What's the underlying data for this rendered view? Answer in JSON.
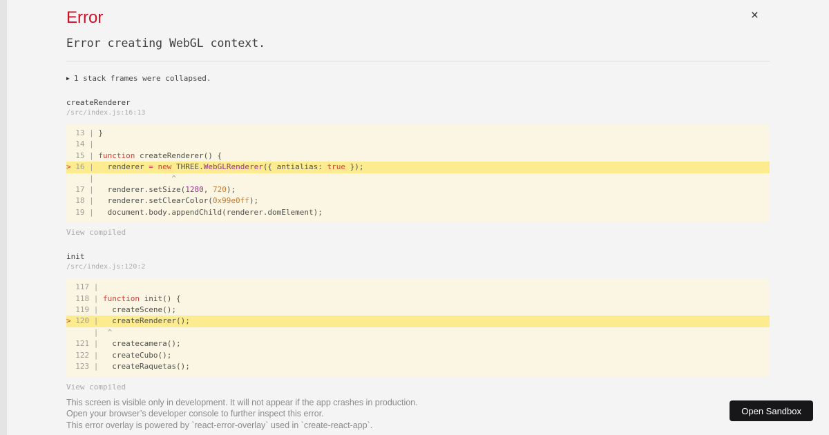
{
  "overlay": {
    "title": "Error",
    "close_glyph": "×",
    "collapse_icon": "▶",
    "message": "Error creating WebGL context.",
    "collapse_note": "1 stack frames were collapsed.",
    "frames": [
      {
        "function": "createRenderer",
        "location": "/src/index.js:16:13",
        "action": "View compiled",
        "code": [
          {
            "hl": false,
            "tokens": [
              [
                "g",
                "  13 | "
              ],
              [
                "d",
                "}"
              ]
            ]
          },
          {
            "hl": false,
            "tokens": [
              [
                "g",
                "  14 |"
              ]
            ]
          },
          {
            "hl": false,
            "tokens": [
              [
                "g",
                "  15 | "
              ],
              [
                "k",
                "function"
              ],
              [
                "d",
                " createRenderer() {"
              ]
            ]
          },
          {
            "hl": true,
            "tokens": [
              [
                "m",
                "> "
              ],
              [
                "g",
                "16 | "
              ],
              [
                "d",
                "  renderer "
              ],
              [
                "k",
                "="
              ],
              [
                "d",
                " "
              ],
              [
                "k",
                "new"
              ],
              [
                "d",
                " THREE."
              ],
              [
                "c",
                "WebGLRenderer"
              ],
              [
                "d",
                "({ antialias: "
              ],
              [
                "k",
                "true"
              ],
              [
                "d",
                " });"
              ]
            ]
          },
          {
            "hl": false,
            "tokens": [
              [
                "g",
                "     |                 ^"
              ]
            ]
          },
          {
            "hl": false,
            "tokens": [
              [
                "g",
                "  17 | "
              ],
              [
                "d",
                "  renderer.setSize("
              ],
              [
                "c",
                "1280"
              ],
              [
                "d",
                ", "
              ],
              [
                "o",
                "720"
              ],
              [
                "d",
                ");"
              ]
            ]
          },
          {
            "hl": false,
            "tokens": [
              [
                "g",
                "  18 | "
              ],
              [
                "d",
                "  renderer.setClearColor("
              ],
              [
                "o",
                "0x99e0ff"
              ],
              [
                "d",
                ");"
              ]
            ]
          },
          {
            "hl": false,
            "tokens": [
              [
                "g",
                "  19 | "
              ],
              [
                "d",
                "  document.body.appendChild(renderer.domElement);"
              ]
            ]
          }
        ]
      },
      {
        "function": "init",
        "location": "/src/index.js:120:2",
        "action": "View compiled",
        "code": [
          {
            "hl": false,
            "tokens": [
              [
                "g",
                "  117 |"
              ]
            ]
          },
          {
            "hl": false,
            "tokens": [
              [
                "g",
                "  118 | "
              ],
              [
                "k",
                "function"
              ],
              [
                "d",
                " init() {"
              ]
            ]
          },
          {
            "hl": false,
            "tokens": [
              [
                "g",
                "  119 | "
              ],
              [
                "d",
                "  createScene();"
              ]
            ]
          },
          {
            "hl": true,
            "tokens": [
              [
                "m",
                "> "
              ],
              [
                "g",
                "120 | "
              ],
              [
                "d",
                "  createRenderer();"
              ]
            ]
          },
          {
            "hl": false,
            "tokens": [
              [
                "g",
                "      |  ^"
              ]
            ]
          },
          {
            "hl": false,
            "tokens": [
              [
                "g",
                "  121 | "
              ],
              [
                "d",
                "  createcamera();"
              ]
            ]
          },
          {
            "hl": false,
            "tokens": [
              [
                "g",
                "  122 | "
              ],
              [
                "d",
                "  createCubo();"
              ]
            ]
          },
          {
            "hl": false,
            "tokens": [
              [
                "g",
                "  123 | "
              ],
              [
                "d",
                "  createRaquetas();"
              ]
            ]
          }
        ]
      }
    ],
    "footer": [
      "This screen is visible only in development. It will not appear if the app crashes in production.",
      "Open your browser’s developer console to further inspect this error.",
      "This error overlay is powered by `react-error-overlay` used in `create-react-app`."
    ],
    "open_sandbox": "Open Sandbox"
  },
  "colors": {
    "accent_red": "#ce1126",
    "code_background": "#faf6e3",
    "highlight_background": "#fceb8f",
    "keyword_red": "#d2413a",
    "class_magenta": "#9b2f8f",
    "number_orange": "#bf7d36",
    "button_black": "#17171a"
  }
}
